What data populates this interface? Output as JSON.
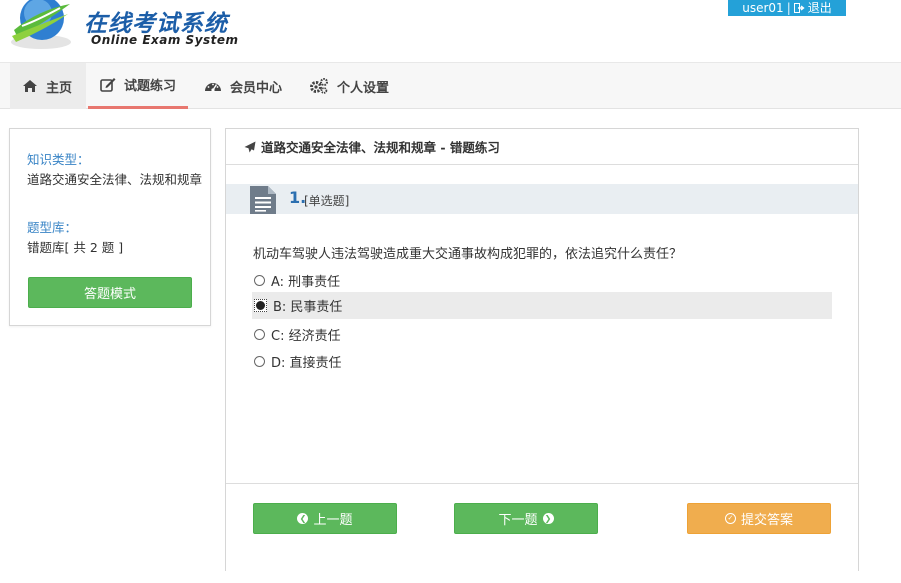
{
  "app": {
    "title": "在线考试系统",
    "subtitle": "Online Exam System"
  },
  "user": {
    "name": "user01",
    "separator": "|",
    "logout_label": "退出"
  },
  "nav": {
    "items": [
      {
        "label": "主页",
        "icon": "home-icon"
      },
      {
        "label": "试题练习",
        "icon": "edit-icon",
        "active": true
      },
      {
        "label": "会员中心",
        "icon": "dashboard-icon"
      },
      {
        "label": "个人设置",
        "icon": "cogs-icon"
      }
    ]
  },
  "sidebar": {
    "knowledge_type_label": "知识类型：",
    "knowledge_type_value": "道路交通安全法律、法规和规章",
    "bank_label": "题型库：",
    "bank_value": "错题库[ 共 2 题 ]",
    "mode_button": "答题模式"
  },
  "panel": {
    "heading": "道路交通安全法律、法规和规章 - 错题练习",
    "question": {
      "number": "1.",
      "type": "[单选题]",
      "text": "机动车驾驶人违法驾驶造成重大交通事故构成犯罪的，依法追究什么责任？",
      "options": [
        {
          "label": "A: 刑事责任",
          "selected": false
        },
        {
          "label": "B: 民事责任",
          "selected": true
        },
        {
          "label": "C: 经济责任",
          "selected": false
        },
        {
          "label": "D: 直接责任",
          "selected": false
        }
      ]
    },
    "buttons": {
      "prev": "上一题",
      "next": "下一题",
      "submit": "提交答案"
    }
  },
  "colors": {
    "primary_blue": "#24a1d8",
    "success": "#5cb85c",
    "warning": "#f0ad4e",
    "nav_active_underline": "#e8776f"
  }
}
